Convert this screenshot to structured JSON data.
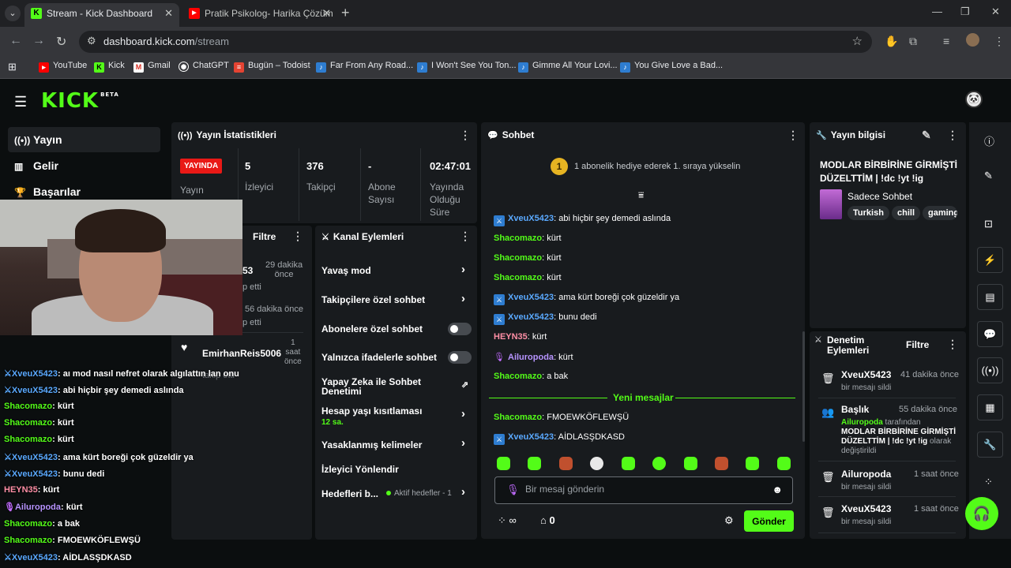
{
  "browser": {
    "tabs": [
      {
        "title": "Stream - Kick Dashboard",
        "favicon": "K"
      },
      {
        "title": "Pratik Psikolog- Harika Çözüm",
        "favicon": "▶"
      }
    ],
    "url_host": "dashboard.kick.com",
    "url_path": "/stream",
    "bookmarks": [
      "YouTube",
      "Kick",
      "Gmail",
      "ChatGPT",
      "Bugün – Todoist",
      "Far From Any Road...",
      "I Won't See You Ton...",
      "Gimme All Your Lovi...",
      "You Give Love a Bad..."
    ]
  },
  "app": {
    "logo": "KICK",
    "logo_beta": "BETA"
  },
  "sidebar": [
    {
      "label": "Yayın",
      "icon": "broadcast-icon"
    },
    {
      "label": "Gelir",
      "icon": "revenue-icon"
    },
    {
      "label": "Başarılar",
      "icon": "trophy-icon"
    }
  ],
  "stats": {
    "title": "Yayın İstatistikleri",
    "live_badge": "YAYINDA",
    "yayin_label": "Yayın",
    "viewers": {
      "value": "5",
      "label": "İzleyici"
    },
    "followers": {
      "value": "376",
      "label": "Takipçi"
    },
    "subs": {
      "value": "-",
      "label1": "Abone",
      "label2": "Sayısı"
    },
    "uptime": {
      "value": "02:47:01",
      "label1": "Yayında",
      "label2": "Olduğu",
      "label3": "Süre"
    }
  },
  "filter_panel": {
    "title": "Filtre",
    "rows": [
      {
        "frag": "53",
        "time1": "29 dakika",
        "time2": "önce",
        "act": "p etti"
      },
      {
        "frag": "",
        "time1": "56 dakika önce",
        "time2": "",
        "act": "p etti"
      },
      {
        "frag": "EmirhanReis5006",
        "time1": "1",
        "time2": "saat",
        "time3": "önce",
        "act": "takip etti"
      }
    ]
  },
  "channel_actions": {
    "title": "Kanal Eylemleri",
    "items": [
      {
        "label": "Yavaş mod"
      },
      {
        "label": "Takipçilere özel sohbet"
      },
      {
        "label": "Abonelere özel sohbet"
      },
      {
        "label": "Yalnızca ifadelerle sohbet"
      },
      {
        "label1": "Yapay Zeka ile Sohbet",
        "label2": "Denetimi"
      },
      {
        "label": "Hesap yaşı kısıtlaması",
        "sub": "12 sa."
      },
      {
        "label": "Yasaklanmış kelimeler"
      },
      {
        "label": "İzleyici Yönlendir"
      },
      {
        "label": "Hedefleri b...",
        "sub": "Aktif hedefler - 1"
      }
    ]
  },
  "chat": {
    "title": "Sohbet",
    "banner_num": "1",
    "banner": "1 abonelik hediye ederek 1. sıraya yükselin",
    "messages": [
      {
        "user": "XveuX5423",
        "text": ": abi hiçbir şey demedi aslında"
      },
      {
        "user": "Shacomazo",
        "text": ": kürt"
      },
      {
        "user": "Shacomazo",
        "text": ": kürt"
      },
      {
        "user": "Shacomazo",
        "text": ": kürt"
      },
      {
        "user": "XveuX5423",
        "text": ": ama kürt boreği çok güzeldir ya"
      },
      {
        "user": "XveuX5423",
        "text": ": bunu dedi"
      },
      {
        "user": "HEYN35",
        "text": ": kürt"
      },
      {
        "user": "Ailuropoda",
        "text": ": kürt"
      },
      {
        "user": "Shacomazo",
        "text": ": a bak"
      }
    ],
    "new_messages_label": "Yeni mesajlar",
    "new_messages": [
      {
        "user": "Shacomazo",
        "text": ": FMOEWKÖFLEWŞÜ"
      },
      {
        "user": "XveuX5423",
        "text": ": AİDLASŞDKASD"
      }
    ],
    "input_placeholder": "Bir mesaj gönderin",
    "points": "∞",
    "gifts": "0",
    "send_label": "Gönder"
  },
  "stream_info": {
    "title": "Yayın bilgisi",
    "stream_title": "MODLAR BİRBİRİNE GİRMİŞTİ DÜZELTTİM | !dc !yt !ig",
    "category": "Sadece Sohbet",
    "tags": [
      "Turkish",
      "chill",
      "gaming"
    ]
  },
  "moderation": {
    "title1": "Denetim",
    "title2": "Eylemleri",
    "filter": "Filtre",
    "items": [
      {
        "name": "XveuX5423",
        "time": "41 dakika önce",
        "action": "bir mesajı sildi"
      },
      {
        "name": "Başlık",
        "time": "55 dakika önce",
        "actor": "Ailuropoda",
        "by": " tarafından",
        "detail1": "MODLAR BİRBİRİNE GİRMİŞTİ",
        "detail2": "DÜZELTTİM | !dc !yt !ig",
        "detail3": " olarak",
        "detail4": "değiştirildi"
      },
      {
        "name": "Ailuropoda",
        "time": "1 saat önce",
        "action": "bir mesajı sildi"
      },
      {
        "name": "XveuX5423",
        "time": "1 saat önce",
        "action": "bir mesajı sildi"
      }
    ]
  },
  "overlay_chat": [
    {
      "user": "XveuX5423",
      "text": ": aı mod nasıl nefret olarak algılattın lan onu"
    },
    {
      "user": "XveuX5423",
      "text": ": abi hiçbir şey demedi aslında"
    },
    {
      "user": "Shacomazo",
      "text": ": kürt"
    },
    {
      "user": "Shacomazo",
      "text": ": kürt"
    },
    {
      "user": "Shacomazo",
      "text": ": kürt"
    },
    {
      "user": "XveuX5423",
      "text": ": ama kürt boreği çok güzeldir ya"
    },
    {
      "user": "XveuX5423",
      "text": ": bunu dedi"
    },
    {
      "user": "HEYN35",
      "text": ": kürt"
    },
    {
      "user": "Ailuropoda",
      "text": ": kürt"
    },
    {
      "user": "Shacomazo",
      "text": ": a bak"
    },
    {
      "user": "Shacomazo",
      "text": ": FMOEWKÖFLEWŞÜ"
    },
    {
      "user": "XveuX5423",
      "text": ": AİDLASŞDKASD"
    }
  ],
  "colors": {
    "kick_green": "#53fc18",
    "live_red": "#e91916",
    "user_blue": "#5aa9ff"
  }
}
